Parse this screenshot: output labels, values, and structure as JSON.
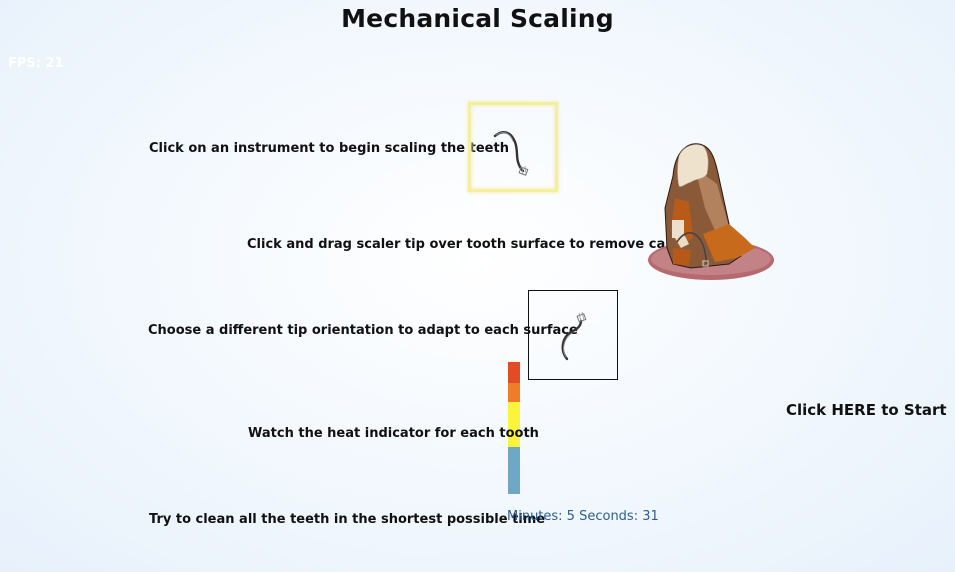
{
  "title": "Mechanical Scaling",
  "fps": "FPS: 21",
  "instructions": {
    "select_instrument": "Click on an instrument to begin scaling the teeth",
    "drag_scaler": "Click and drag scaler tip over tooth surface to remove calculus",
    "tip_orientation": "Choose a different tip orientation to adapt to each surface",
    "heat_indicator": "Watch the heat indicator for each tooth",
    "clean_time": "Try to clean all the teeth in the shortest possible time"
  },
  "timer": "Minutes: 5 Seconds: 31",
  "start_label": "Click HERE to Start",
  "heat_colors": {
    "red": "#e34a26",
    "orange": "#ee7d28",
    "yellow": "#fbf33c",
    "blue": "#6fa8c6"
  },
  "icons": {
    "instrument_1": "scaler-instrument-icon",
    "instrument_2": "scaler-tip-orientation-icon",
    "tooth": "tooth-with-calculus-icon"
  }
}
